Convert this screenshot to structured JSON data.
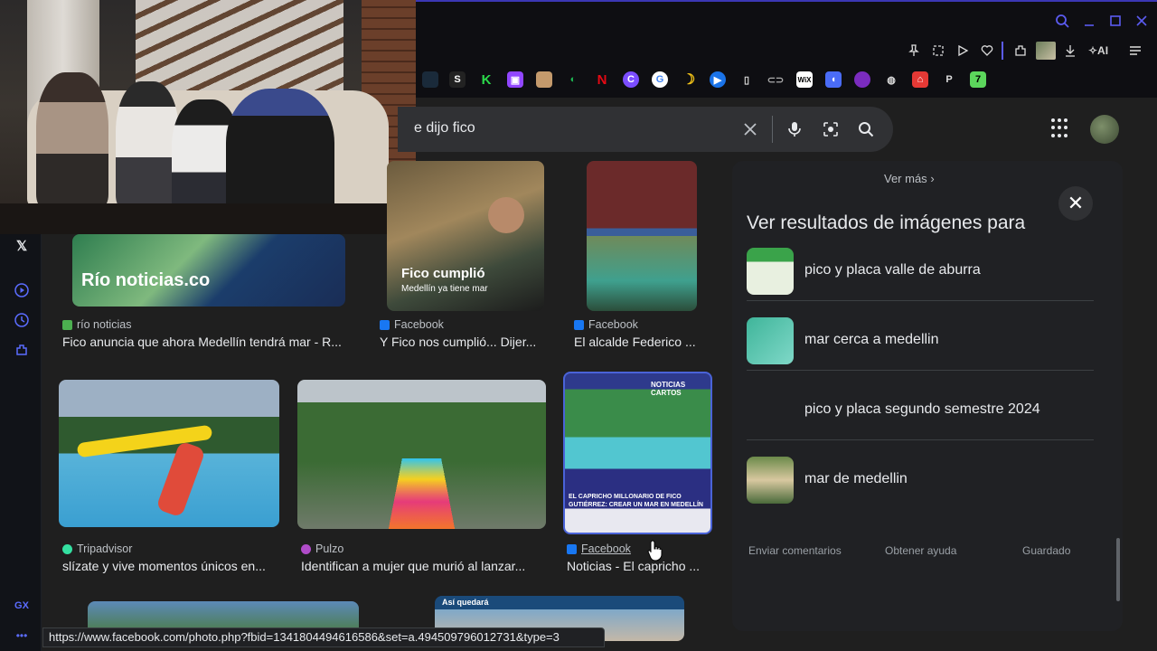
{
  "search": {
    "query_visible": "e dijo fico"
  },
  "bookmarks": [
    {
      "icon": "twitch-icon",
      "color": "#9146ff",
      "glyph": "T"
    },
    {
      "icon": "netflix-icon",
      "color": "#e50914",
      "glyph": "N"
    },
    {
      "icon": "google-icon",
      "color": "#ffffff",
      "glyph": "G"
    }
  ],
  "toolbar": {
    "ai_label": "AI"
  },
  "results_row1": [
    {
      "source": "río noticias",
      "title": "Fico anuncia que ahora Medellín tendrá mar - R...",
      "overlay": "Río noticias.co"
    },
    {
      "source": "Facebook",
      "title": "Y Fico nos cumplió... Dijer...",
      "overlay": "Fico cumplió",
      "overlay2": "Medellín ya tiene mar"
    },
    {
      "source": "Facebook",
      "title": "El alcalde Federico ..."
    }
  ],
  "results_row2": [
    {
      "source": "Tripadvisor",
      "title": "slízate y vive momentos únicos en..."
    },
    {
      "source": "Pulzo",
      "title": "Identifican a mujer que murió al lanzar..."
    },
    {
      "source": "Facebook",
      "title": "Noticias - El capricho ...",
      "overlay": "NOTICIAS CARTOS",
      "overlay2": "EL CAPRICHO MILLONARIO DE FICO GUTIÉRREZ: CREAR UN MAR EN MEDELLÍN"
    }
  ],
  "results_row3": [
    {
      "overlay": "Así quedará"
    }
  ],
  "panel": {
    "ver_mas": "Ver más",
    "heading": "Ver resultados de imágenes para",
    "related": [
      {
        "label": "pico y placa valle de aburra"
      },
      {
        "label": "mar cerca a medellin"
      },
      {
        "label": "pico y placa segundo semestre 2024"
      },
      {
        "label": "mar de medellin"
      }
    ],
    "footer": {
      "feedback": "Enviar comentarios",
      "help": "Obtener ayuda",
      "saved": "Guardado"
    }
  },
  "sidebar": {
    "gx_label": "GX",
    "more_label": "•••"
  },
  "status_url": "https://www.facebook.com/photo.php?fbid=1341804494616586&set=a.494509796012731&type=3",
  "colors": {
    "accent": "#5b5bf0",
    "background": "#1f1f1f",
    "panel": "#202124"
  }
}
